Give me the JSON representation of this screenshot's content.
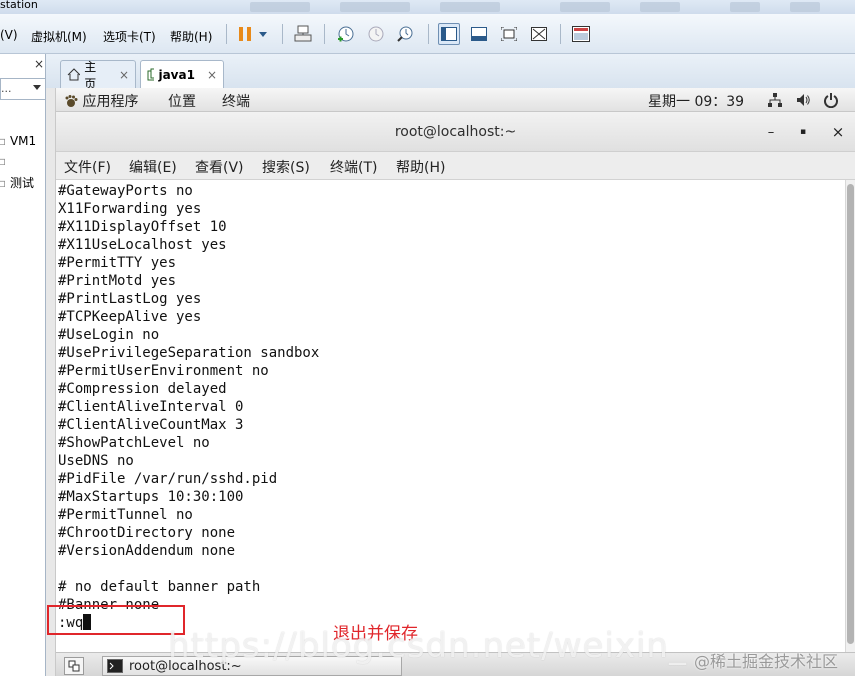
{
  "host": {
    "title_fragment": "station",
    "menu": [
      "(V)",
      "虚拟机(M)",
      "选项卡(T)",
      "帮助(H)"
    ],
    "toolbar_icons": [
      "pause-icon",
      "dropdown-arrow-icon",
      "send-ctrl-alt-del-icon",
      "snapshot-take-icon",
      "snapshot-revert-icon",
      "snapshot-manager-icon",
      "view-library-icon",
      "view-console-icon",
      "fullscreen-icon",
      "unity-icon",
      "thumbnail-icon"
    ]
  },
  "library": {
    "close": "×",
    "dropdown_value": "...",
    "items": [
      "VM1",
      "",
      "测试"
    ]
  },
  "vm_tabs": [
    {
      "label": "主页",
      "close": "×"
    },
    {
      "label": "java1",
      "close": "×"
    }
  ],
  "gnome": {
    "apps": "应用程序",
    "places": "位置",
    "terminal": "终端",
    "clock": "星期一 09：39"
  },
  "terminal": {
    "title": "root@localhost:~",
    "btn_min": "–",
    "btn_max": "▪",
    "btn_close": "×",
    "menu": [
      "文件(F)",
      "编辑(E)",
      "查看(V)",
      "搜索(S)",
      "终端(T)",
      "帮助(H)"
    ],
    "lines": [
      "#GatewayPorts no",
      "X11Forwarding yes",
      "#X11DisplayOffset 10",
      "#X11UseLocalhost yes",
      "#PermitTTY yes",
      "#PrintMotd yes",
      "#PrintLastLog yes",
      "#TCPKeepAlive yes",
      "#UseLogin no",
      "#UsePrivilegeSeparation sandbox",
      "#PermitUserEnvironment no",
      "#Compression delayed",
      "#ClientAliveInterval 0",
      "#ClientAliveCountMax 3",
      "#ShowPatchLevel no",
      "UseDNS no",
      "#PidFile /var/run/sshd.pid",
      "#MaxStartups 10:30:100",
      "#PermitTunnel no",
      "#ChrootDirectory none",
      "#VersionAddendum none",
      "",
      "# no default banner path",
      "#Banner none"
    ],
    "command": ":wq"
  },
  "annotation": "退出并保存",
  "taskbar": {
    "window_label": "root@localhost:~"
  },
  "watermark": {
    "url": "https://blog.csdn.net/weixin_",
    "credit": "@稀土掘金技术社区"
  }
}
